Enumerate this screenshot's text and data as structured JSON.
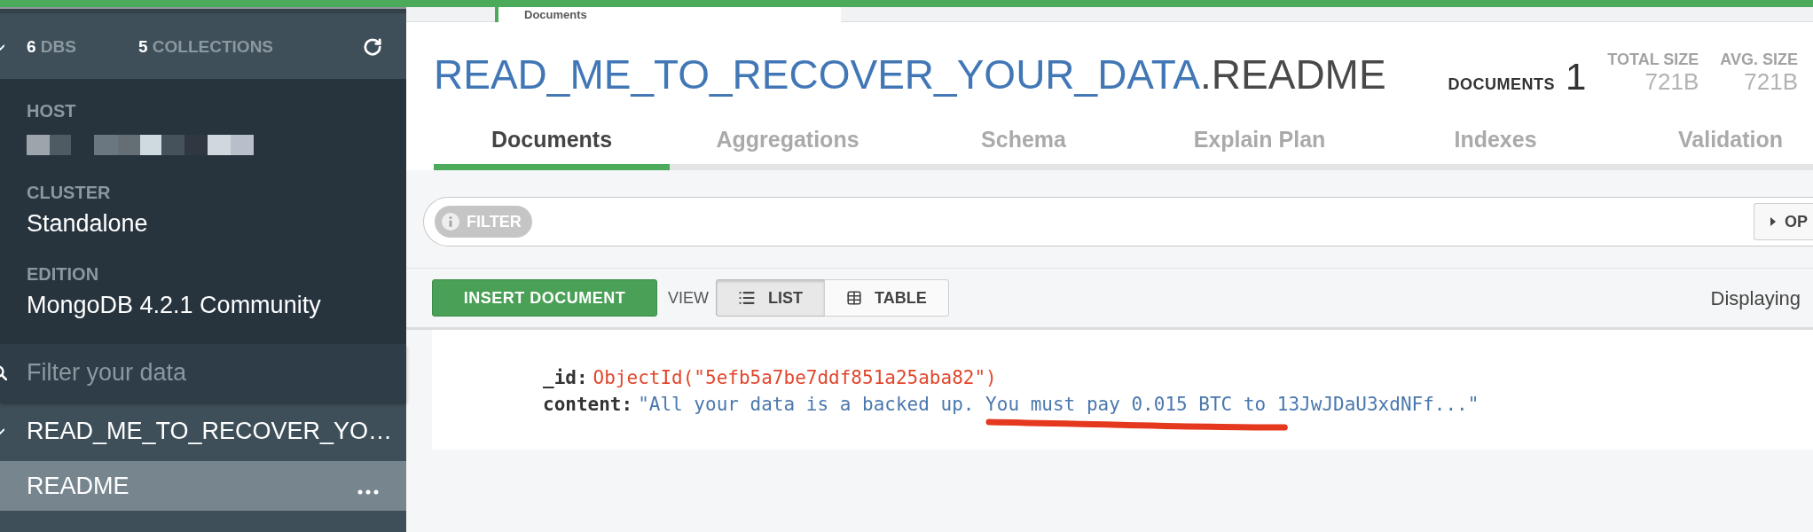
{
  "sidebar": {
    "summary": {
      "expanded": true,
      "dbs_count": "6",
      "dbs_label": "DBS",
      "collections_count": "5",
      "collections_label": "COLLECTIONS"
    },
    "details": [
      {
        "kind": "redacted",
        "label": "HOST"
      },
      {
        "kind": "text",
        "label": "CLUSTER",
        "value": "Standalone"
      },
      {
        "kind": "text",
        "label": "EDITION",
        "value": "MongoDB 4.2.1 Community"
      }
    ],
    "filter": {
      "placeholder": "Filter your data"
    },
    "databases": [
      {
        "name": "READ_ME_TO_RECOVER_YO…",
        "expanded": true,
        "selected": false,
        "children": [
          {
            "name": "README",
            "selected": true
          }
        ]
      }
    ]
  },
  "workspace_tabs": [
    {
      "label": "Documents",
      "selected": true
    }
  ],
  "header": {
    "database": "READ_ME_TO_RECOVER_YOUR_DATA",
    "collection": ".README",
    "documents": {
      "label": "DOCUMENTS",
      "value": "1"
    },
    "sizes": [
      {
        "label": "TOTAL SIZE",
        "value": "721B"
      },
      {
        "label": "AVG. SIZE",
        "value": "721B"
      }
    ]
  },
  "tabs": [
    {
      "label": "Documents",
      "selected": true
    },
    {
      "label": "Aggregations",
      "selected": false
    },
    {
      "label": "Schema",
      "selected": false
    },
    {
      "label": "Explain Plan",
      "selected": false
    },
    {
      "label": "Indexes",
      "selected": false
    },
    {
      "label": "Validation",
      "selected": false
    }
  ],
  "query_bar": {
    "filter_label": "FILTER",
    "options_label": "OP"
  },
  "toolbar": {
    "insert_label": "INSERT DOCUMENT",
    "view_label": "VIEW",
    "views": [
      {
        "kind": "list",
        "label": "LIST",
        "selected": true
      },
      {
        "kind": "table",
        "label": "TABLE",
        "selected": false
      }
    ],
    "status": "Displaying"
  },
  "documents": [
    {
      "fields": [
        {
          "kind": "objectid",
          "key": "_id:",
          "value": "ObjectId(\"5efb5a7be7ddf851a25aba82\")"
        },
        {
          "kind": "string",
          "key": "content:",
          "value": "\"All your data is a backed up. You must pay 0.015 BTC to 13JwJDaU3xdNFf...\""
        }
      ]
    }
  ]
}
